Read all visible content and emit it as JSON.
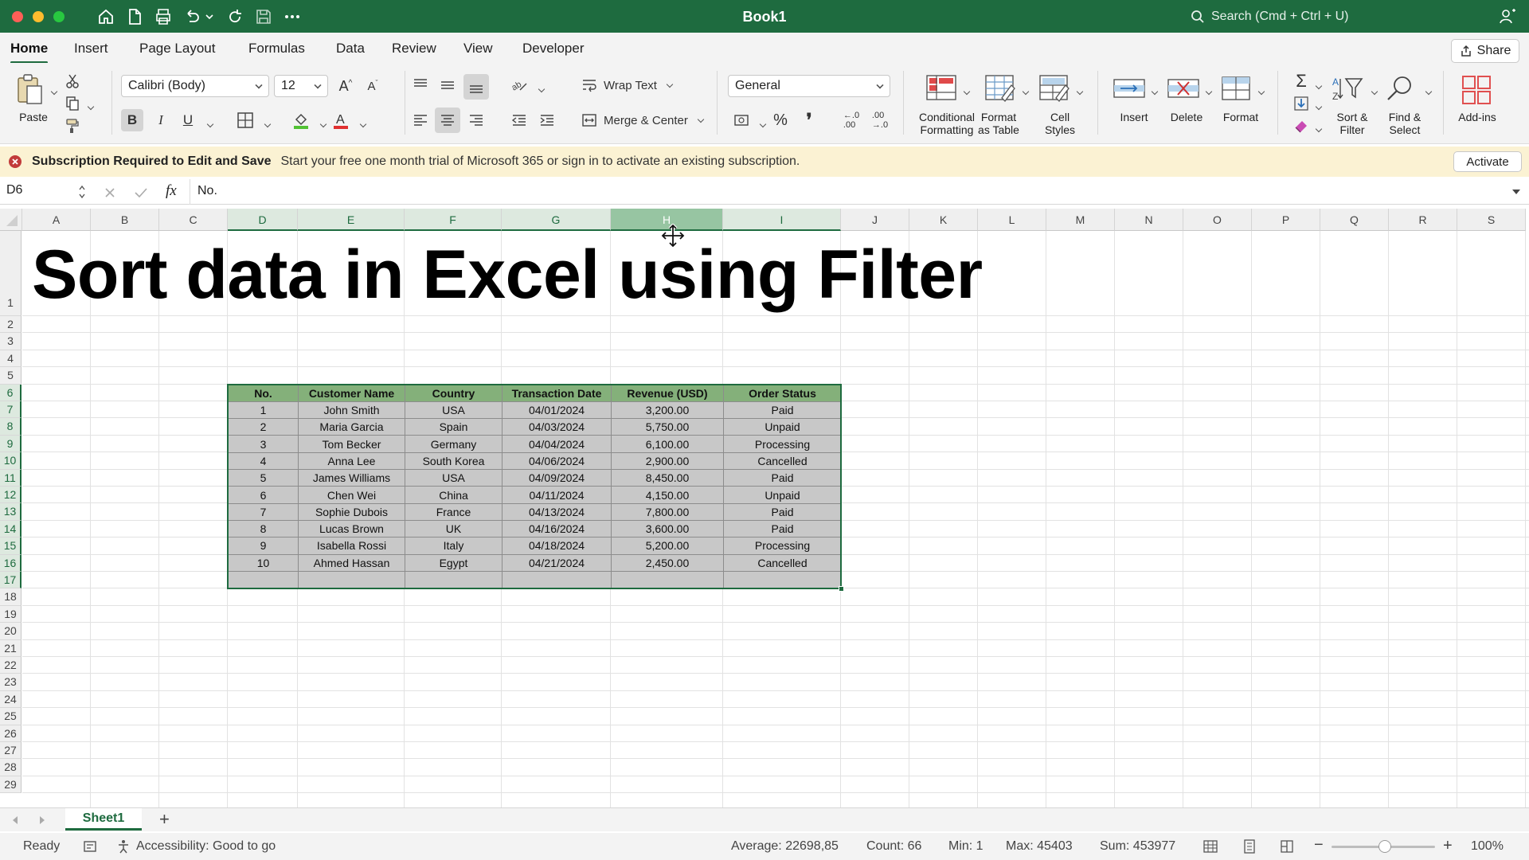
{
  "window": {
    "title": "Book1",
    "search_placeholder": "Search (Cmd + Ctrl + U)",
    "traffic_colors": [
      "#ff5f57",
      "#febc2e",
      "#28c840"
    ]
  },
  "tabs": [
    "Home",
    "Insert",
    "Page Layout",
    "Formulas",
    "Data",
    "Review",
    "View",
    "Developer"
  ],
  "active_tab": "Home",
  "share_label": "Share",
  "ribbon": {
    "paste": "Paste",
    "font_name": "Calibri (Body)",
    "font_size": "12",
    "wrap_text": "Wrap Text",
    "merge_center": "Merge & Center",
    "number_format": "General",
    "conditional_formatting": [
      "Conditional",
      "Formatting"
    ],
    "format_as_table": [
      "Format",
      "as Table"
    ],
    "cell_styles": [
      "Cell",
      "Styles"
    ],
    "insert": "Insert",
    "delete": "Delete",
    "format": "Format",
    "sort_filter": [
      "Sort &",
      "Filter"
    ],
    "find_select": [
      "Find &",
      "Select"
    ],
    "add_ins": "Add-ins"
  },
  "notice": {
    "bold": "Subscription Required to Edit and Save",
    "text": "Start your free one month trial of Microsoft 365 or sign in to activate an existing subscription.",
    "activate": "Activate"
  },
  "formula_bar": {
    "name_box": "D6",
    "fx": "fx",
    "content": "No."
  },
  "columns": [
    "A",
    "B",
    "C",
    "D",
    "E",
    "F",
    "G",
    "H",
    "I",
    "J",
    "K",
    "L",
    "M",
    "N",
    "O",
    "P",
    "Q",
    "R",
    "S"
  ],
  "rows": [
    "1",
    "2",
    "3",
    "4",
    "5",
    "6",
    "7",
    "8",
    "9",
    "10",
    "11",
    "12",
    "13",
    "14",
    "15",
    "16",
    "17",
    "18",
    "19",
    "20",
    "21",
    "22",
    "23",
    "24",
    "25",
    "26",
    "27",
    "28",
    "29"
  ],
  "sheet_title": "Sort data in Excel using Filter",
  "table": {
    "headers": [
      "No.",
      "Customer Name",
      "Country",
      "Transaction Date",
      "Revenue (USD)",
      "Order Status"
    ],
    "rows": [
      [
        "1",
        "John Smith",
        "USA",
        "04/01/2024",
        "3,200.00",
        "Paid"
      ],
      [
        "2",
        "Maria Garcia",
        "Spain",
        "04/03/2024",
        "5,750.00",
        "Unpaid"
      ],
      [
        "3",
        "Tom Becker",
        "Germany",
        "04/04/2024",
        "6,100.00",
        "Processing"
      ],
      [
        "4",
        "Anna Lee",
        "South Korea",
        "04/06/2024",
        "2,900.00",
        "Cancelled"
      ],
      [
        "5",
        "James Williams",
        "USA",
        "04/09/2024",
        "8,450.00",
        "Paid"
      ],
      [
        "6",
        "Chen Wei",
        "China",
        "04/11/2024",
        "4,150.00",
        "Unpaid"
      ],
      [
        "7",
        "Sophie Dubois",
        "France",
        "04/13/2024",
        "7,800.00",
        "Paid"
      ],
      [
        "8",
        "Lucas Brown",
        "UK",
        "04/16/2024",
        "3,600.00",
        "Paid"
      ],
      [
        "9",
        "Isabella Rossi",
        "Italy",
        "04/18/2024",
        "5,200.00",
        "Processing"
      ],
      [
        "10",
        "Ahmed Hassan",
        "Egypt",
        "04/21/2024",
        "2,450.00",
        "Cancelled"
      ],
      [
        "",
        "",
        "",
        "",
        "",
        ""
      ]
    ]
  },
  "sheet_tabs": [
    "Sheet1"
  ],
  "add_sheet": "+",
  "status": {
    "ready": "Ready",
    "accessibility": "Accessibility: Good to go",
    "average": "Average: 22698,85",
    "count": "Count: 66",
    "min": "Min: 1",
    "max": "Max: 45403",
    "sum": "Sum: 453977",
    "zoom": "100%",
    "zoom_minus": "−",
    "zoom_plus": "+"
  },
  "colors": {
    "brand_green": "#1e6b3f",
    "header_fill": "#84b07a",
    "body_fill": "#c8c8c8",
    "notice_bg": "#fbf2d3"
  }
}
